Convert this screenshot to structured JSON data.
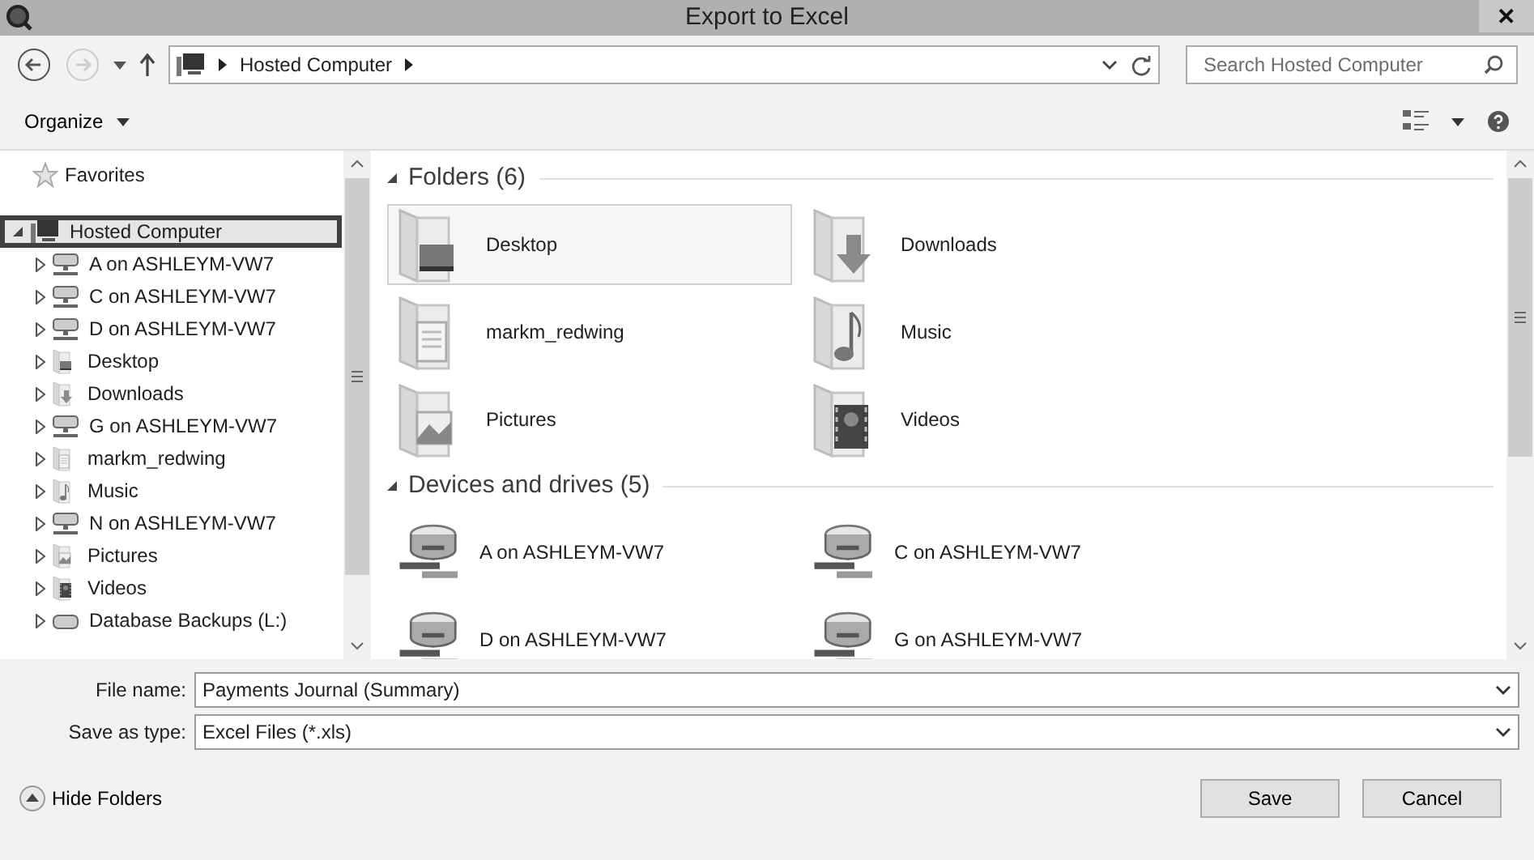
{
  "window": {
    "title": "Export to Excel",
    "close": "✕"
  },
  "navigation": {
    "back": {
      "disabled": false
    },
    "forward": {
      "disabled": true
    },
    "path": [
      "Hosted Computer"
    ],
    "search": {
      "placeholder": "Search Hosted Computer"
    }
  },
  "toolbar": {
    "organize": "Organize"
  },
  "tree": {
    "favorites": "Favorites",
    "items": [
      {
        "label": "Hosted Computer",
        "kind": "computer",
        "expanded": true,
        "selected": true,
        "children": [
          {
            "label": "A on ASHLEYM-VW7",
            "kind": "network",
            "expanded": false,
            "selected": false
          },
          {
            "label": "C on ASHLEYM-VW7",
            "kind": "network",
            "expanded": false,
            "selected": false
          },
          {
            "label": "D on ASHLEYM-VW7",
            "kind": "network",
            "expanded": false,
            "selected": false
          },
          {
            "label": "Desktop",
            "kind": "desktop",
            "expanded": false,
            "selected": false
          },
          {
            "label": "Downloads",
            "kind": "downloads",
            "expanded": false,
            "selected": false
          },
          {
            "label": "G on ASHLEYM-VW7",
            "kind": "network",
            "expanded": false,
            "selected": false
          },
          {
            "label": "markm_redwing",
            "kind": "user",
            "expanded": false,
            "selected": false
          },
          {
            "label": "Music",
            "kind": "music",
            "expanded": false,
            "selected": false
          },
          {
            "label": "N on ASHLEYM-VW7",
            "kind": "network",
            "expanded": false,
            "selected": false
          },
          {
            "label": "Pictures",
            "kind": "pictures",
            "expanded": false,
            "selected": false
          },
          {
            "label": "Videos",
            "kind": "videos",
            "expanded": false,
            "selected": false
          },
          {
            "label": "Database Backups (L:)",
            "kind": "drive",
            "expanded": false,
            "selected": false
          }
        ]
      }
    ]
  },
  "content": {
    "groups": [
      {
        "title": "Folders (6)",
        "expanded": true,
        "items": [
          {
            "label": "Desktop",
            "kind": "desktop",
            "selected": true
          },
          {
            "label": "Downloads",
            "kind": "downloads",
            "selected": false
          },
          {
            "label": "markm_redwing",
            "kind": "user",
            "selected": false
          },
          {
            "label": "Music",
            "kind": "music",
            "selected": false
          },
          {
            "label": "Pictures",
            "kind": "pictures",
            "selected": false
          },
          {
            "label": "Videos",
            "kind": "videos",
            "selected": false
          }
        ]
      },
      {
        "title": "Devices and drives (5)",
        "expanded": true,
        "items": [
          {
            "label": "A on ASHLEYM-VW7",
            "kind": "network",
            "selected": false
          },
          {
            "label": "C on ASHLEYM-VW7",
            "kind": "network",
            "selected": false
          },
          {
            "label": "D on ASHLEYM-VW7",
            "kind": "network",
            "selected": false
          },
          {
            "label": "G on ASHLEYM-VW7",
            "kind": "network",
            "selected": false
          }
        ]
      }
    ]
  },
  "form": {
    "fields": [
      {
        "label": "File name:",
        "value": "Payments Journal (Summary)"
      },
      {
        "label": "Save as type:",
        "value": "Excel Files (*.xls)"
      }
    ]
  },
  "footer": {
    "toggle": "Hide Folders",
    "buttons": [
      "Save",
      "Cancel"
    ]
  }
}
